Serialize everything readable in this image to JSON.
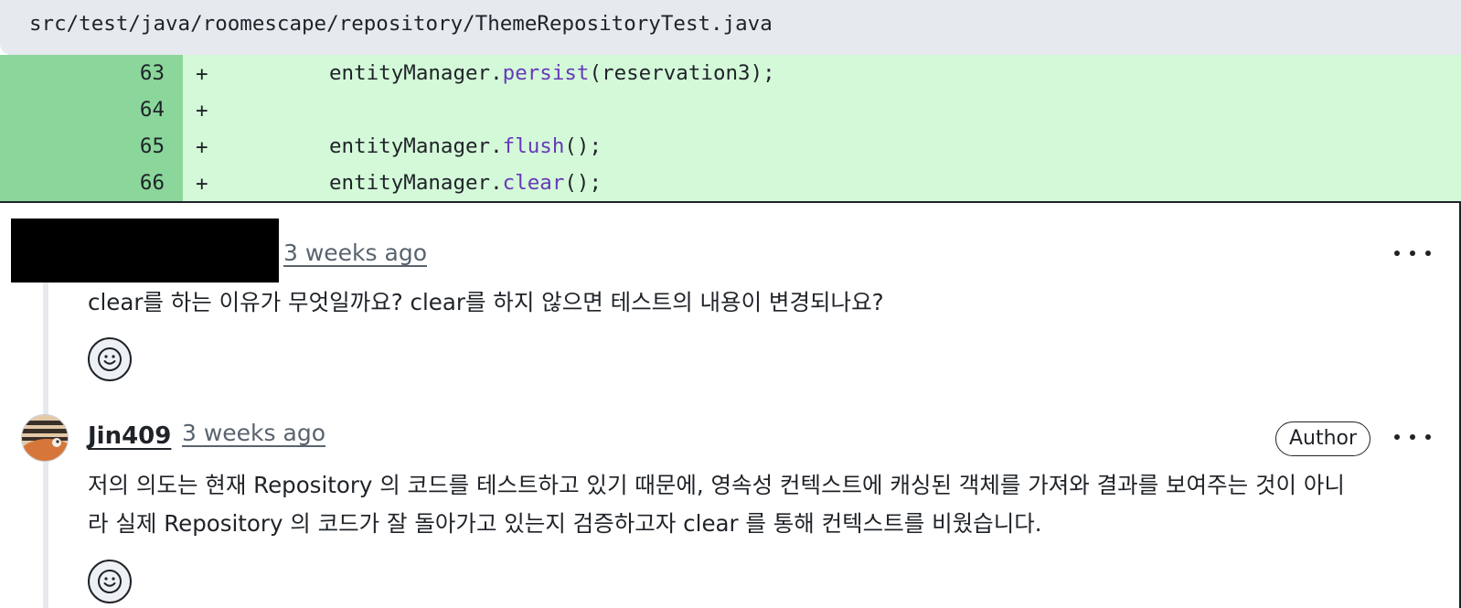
{
  "file": {
    "path": "src/test/java/roomescape/repository/ThemeRepositoryTest.java"
  },
  "diff": {
    "lines": [
      {
        "number": "63",
        "marker": "+",
        "code_obj": "entityManager.",
        "code_method": "persist",
        "code_rest": "(reservation3);"
      },
      {
        "number": "64",
        "marker": "+",
        "code_obj": "",
        "code_method": "",
        "code_rest": ""
      },
      {
        "number": "65",
        "marker": "+",
        "code_obj": "entityManager.",
        "code_method": "flush",
        "code_rest": "();"
      },
      {
        "number": "66",
        "marker": "+",
        "code_obj": "entityManager.",
        "code_method": "clear",
        "code_rest": "();"
      }
    ]
  },
  "comments": [
    {
      "author": "",
      "author_redacted": true,
      "timestamp": "3 weeks ago",
      "body": "clear를 하는 이유가 무엇일까요? clear를 하지 않으면 테스트의 내용이 변경되나요?",
      "reaction_icon": "smiley-icon",
      "menu_icon": "kebab-horizontal-icon"
    },
    {
      "author": "Jin409",
      "badge": "Author",
      "timestamp": "3 weeks ago",
      "body_line1": "저의 의도는 현재 Repository 의 코드를 테스트하고 있기 때문에, 영속성 컨텍스트에 캐싱된 객체를 가져와 결과를 보여주는 것이 아니",
      "body_line2": "라 실제 Repository 의 코드가 잘 돌아가고 있는지 검증하고자 clear 를 통해 컨텍스트를 비웠습니다.",
      "reaction_icon": "smiley-icon",
      "menu_icon": "kebab-horizontal-icon",
      "avatar_icon": "user-avatar"
    }
  ],
  "colors": {
    "gutter_added": "#8bd79b",
    "code_added": "#d4f9d9",
    "method": "#6639ba",
    "header_bg": "#e6e9ee",
    "muted_text": "#59636e"
  }
}
